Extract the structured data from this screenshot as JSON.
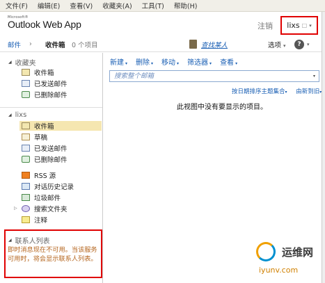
{
  "menubar": [
    "文件(F)",
    "编辑(E)",
    "查看(V)",
    "收藏夹(A)",
    "工具(T)",
    "帮助(H)"
  ],
  "header": {
    "logo_small": "Microsoft®",
    "logo_text": "Outlook Web App",
    "signout": "注销",
    "user": "lixs"
  },
  "crumb": {
    "mail": "邮件",
    "separator": "›",
    "inbox": "收件箱",
    "count": "0 个项目",
    "find": "查找某人",
    "options": "选项",
    "options_arrow": "▾",
    "help": "?",
    "help_arrow": "▾"
  },
  "favorites": {
    "title": "收藏夹",
    "items": [
      "收件箱",
      "已发送邮件",
      "已删除邮件"
    ]
  },
  "mailbox": {
    "title": "lixs",
    "items": [
      "收件箱",
      "草稿",
      "已发送邮件",
      "已删除邮件",
      "RSS 源",
      "对话历史记录",
      "垃圾邮件",
      "搜索文件夹",
      "注释"
    ]
  },
  "contacts": {
    "title": "联系人列表",
    "message": "即时消息现在不可用。当该服务可用时，将会显示联系人列表。"
  },
  "toolbar": [
    "新建",
    "删除",
    "移动",
    "筛选器",
    "查看"
  ],
  "search": {
    "placeholder": "搜索整个邮箱"
  },
  "sort": {
    "by": "按日期排序主题集合",
    "order": "由新到旧"
  },
  "empty_message": "此视图中没有要显示的项目。",
  "watermark": {
    "title": "运维网",
    "url": "iyunv.com"
  },
  "colors": {
    "accent": "#1a5fb4",
    "highlight_border": "#e00000",
    "selected_folder": "#f5e6b0",
    "warning_text": "#b5651d"
  }
}
